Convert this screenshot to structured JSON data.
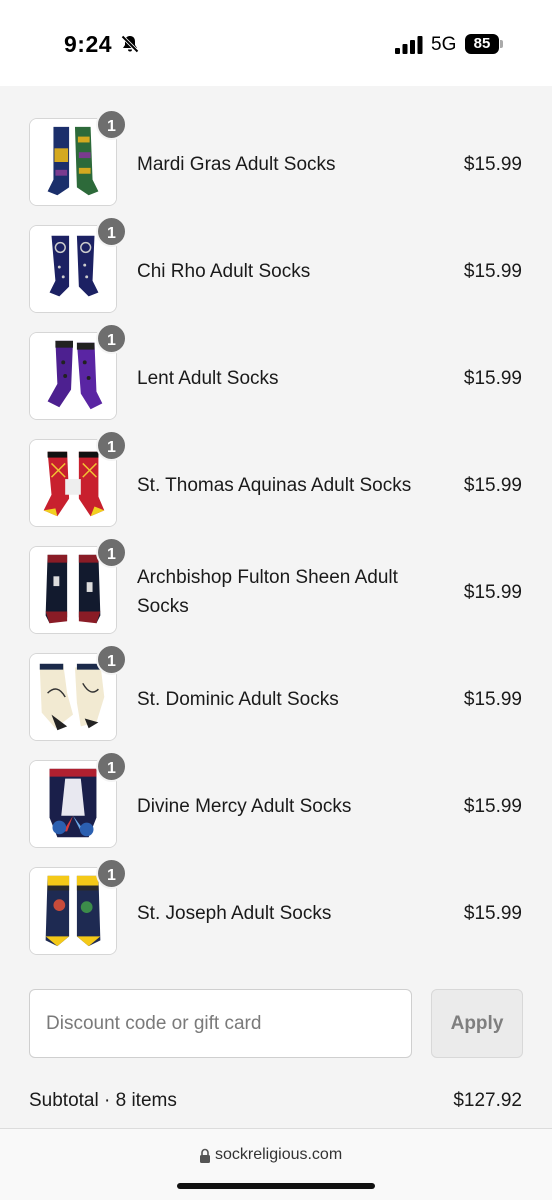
{
  "status_bar": {
    "time": "9:24",
    "network": "5G",
    "battery": "85",
    "icons": [
      "bell-slash-icon",
      "signal-bars-icon",
      "battery-icon"
    ]
  },
  "cart": {
    "items": [
      {
        "name": "Mardi Gras Adult Socks",
        "price": "$15.99",
        "quantity": "1"
      },
      {
        "name": "Chi Rho Adult Socks",
        "price": "$15.99",
        "quantity": "1"
      },
      {
        "name": "Lent Adult Socks",
        "price": "$15.99",
        "quantity": "1"
      },
      {
        "name": "St. Thomas Aquinas Adult Socks",
        "price": "$15.99",
        "quantity": "1"
      },
      {
        "name": "Archbishop Fulton Sheen Adult Socks",
        "price": "$15.99",
        "quantity": "1"
      },
      {
        "name": "St. Dominic Adult Socks",
        "price": "$15.99",
        "quantity": "1"
      },
      {
        "name": "Divine Mercy Adult Socks",
        "price": "$15.99",
        "quantity": "1"
      },
      {
        "name": "St. Joseph Adult Socks",
        "price": "$15.99",
        "quantity": "1"
      }
    ]
  },
  "discount": {
    "placeholder": "Discount code or gift card",
    "apply_label": "Apply"
  },
  "subtotal": {
    "label": "Subtotal · 8 items",
    "value": "$127.92"
  },
  "browser": {
    "url": "sockreligious.com"
  },
  "colors": {
    "page_background": "#f4f4f4",
    "badge": "#6e6e6e",
    "apply_button": "#ebebeb"
  }
}
